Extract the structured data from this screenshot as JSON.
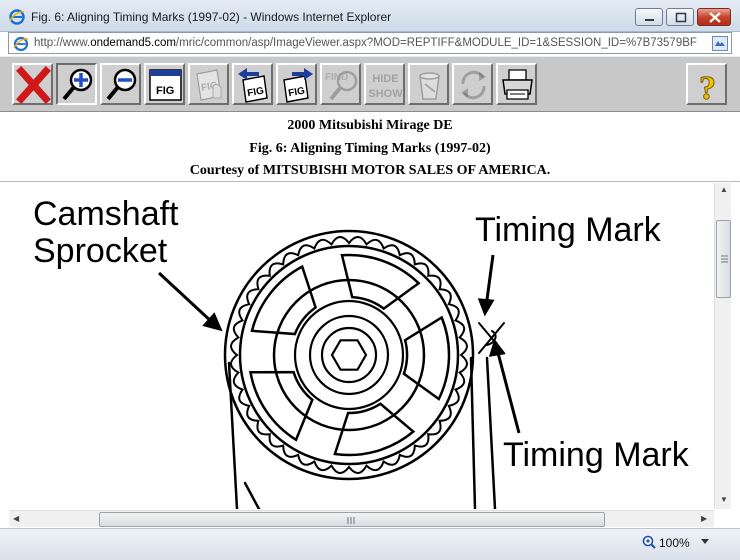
{
  "window": {
    "title": "Fig. 6: Aligning Timing Marks (1997-02) - Windows Internet Explorer",
    "buttons": [
      "minimize",
      "maximize",
      "close"
    ]
  },
  "address": {
    "url_prefix": "http://www.",
    "url_domain": "ondemand5.com",
    "url_rest": "/mric/common/asp/ImageViewer.aspx?MOD=REPTIFF&MODULE_ID=1&SESSION_ID=%7B73579BF"
  },
  "toolbar": {
    "items": [
      {
        "icon": "close-x-icon",
        "enabled": true
      },
      {
        "icon": "zoom-in-icon",
        "enabled": true
      },
      {
        "icon": "zoom-out-icon",
        "enabled": true
      },
      {
        "icon": "fit-window-icon",
        "label": "FIG",
        "enabled": true
      },
      {
        "icon": "fig-hand-icon",
        "label": "FIG",
        "enabled": false
      },
      {
        "icon": "previous-fig-icon",
        "label": "FIG",
        "enabled": true
      },
      {
        "icon": "next-fig-icon",
        "label": "FIG",
        "enabled": true
      },
      {
        "icon": "find-icon",
        "label": "FIND",
        "enabled": false
      },
      {
        "icon": "hide-show-icon",
        "label": "HIDE SHOW",
        "enabled": false
      },
      {
        "icon": "bucket-icon",
        "enabled": false
      },
      {
        "icon": "rotate-icon",
        "enabled": false
      },
      {
        "icon": "print-icon",
        "enabled": true
      },
      {
        "icon": "help-icon",
        "label": "?",
        "enabled": true
      }
    ],
    "fig_label": "FIG",
    "find_label": "FIND",
    "hide_label": "HIDE",
    "show_label": "SHOW",
    "help_label": "?"
  },
  "header": {
    "line1": "2000 Mitsubishi Mirage DE",
    "line2": "Fig. 6: Aligning Timing Marks (1997-02)",
    "line3": "Courtesy of MITSUBISHI MOTOR SALES OF AMERICA."
  },
  "figure": {
    "labels": {
      "camshaft_line1": "Camshaft",
      "camshaft_line2": "Sprocket",
      "timing_mark_top": "Timing Mark",
      "timing_mark_bottom": "Timing Mark"
    }
  },
  "status": {
    "zoom": "100%"
  },
  "colors": {
    "title_bar": "#cfdbea",
    "toolbar": "#c8c8c8",
    "close_red": "#c8432c"
  }
}
